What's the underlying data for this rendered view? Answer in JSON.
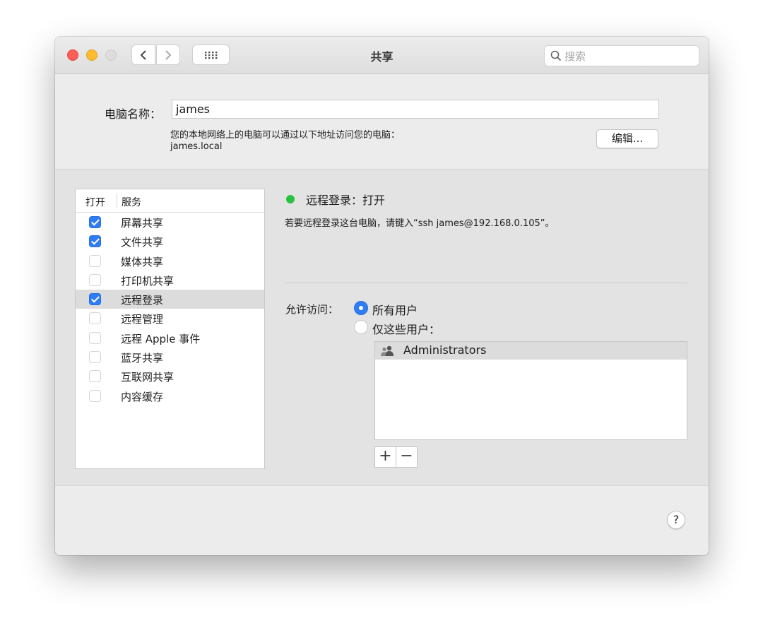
{
  "window": {
    "title": "共享"
  },
  "toolbar": {
    "back_icon": "chevron-left-icon",
    "forward_icon": "chevron-right-icon",
    "grid_icon": "grid-icon",
    "search_placeholder": "搜索"
  },
  "computer": {
    "name_label": "电脑名称：",
    "name_value": "james",
    "address_desc": "您的本地网络上的电脑可以通过以下地址访问您的电脑：",
    "address_host": "james.local",
    "edit_label": "编辑..."
  },
  "services": {
    "header_open": "打开",
    "header_service": "服务",
    "items": [
      {
        "label": "屏幕共享",
        "checked": true
      },
      {
        "label": "文件共享",
        "checked": true
      },
      {
        "label": "媒体共享",
        "checked": false
      },
      {
        "label": "打印机共享",
        "checked": false
      },
      {
        "label": "远程登录",
        "checked": true,
        "selected": true
      },
      {
        "label": "远程管理",
        "checked": false
      },
      {
        "label": "远程 Apple 事件",
        "checked": false
      },
      {
        "label": "蓝牙共享",
        "checked": false
      },
      {
        "label": "互联网共享",
        "checked": false
      },
      {
        "label": "内容缓存",
        "checked": false
      }
    ]
  },
  "detail": {
    "status": "远程登录：打开",
    "status_color": "#29c13f",
    "hint": "若要远程登录这台电脑，请键入“ssh james@192.168.0.105”。",
    "access_label": "允许访问：",
    "option_all": "所有用户",
    "option_some": "仅这些用户：",
    "selected_option": "all",
    "users": [
      "Administrators"
    ],
    "add_label": "+",
    "remove_label": "−"
  },
  "help_label": "?",
  "colors": {
    "accent": "#2f7df6"
  }
}
